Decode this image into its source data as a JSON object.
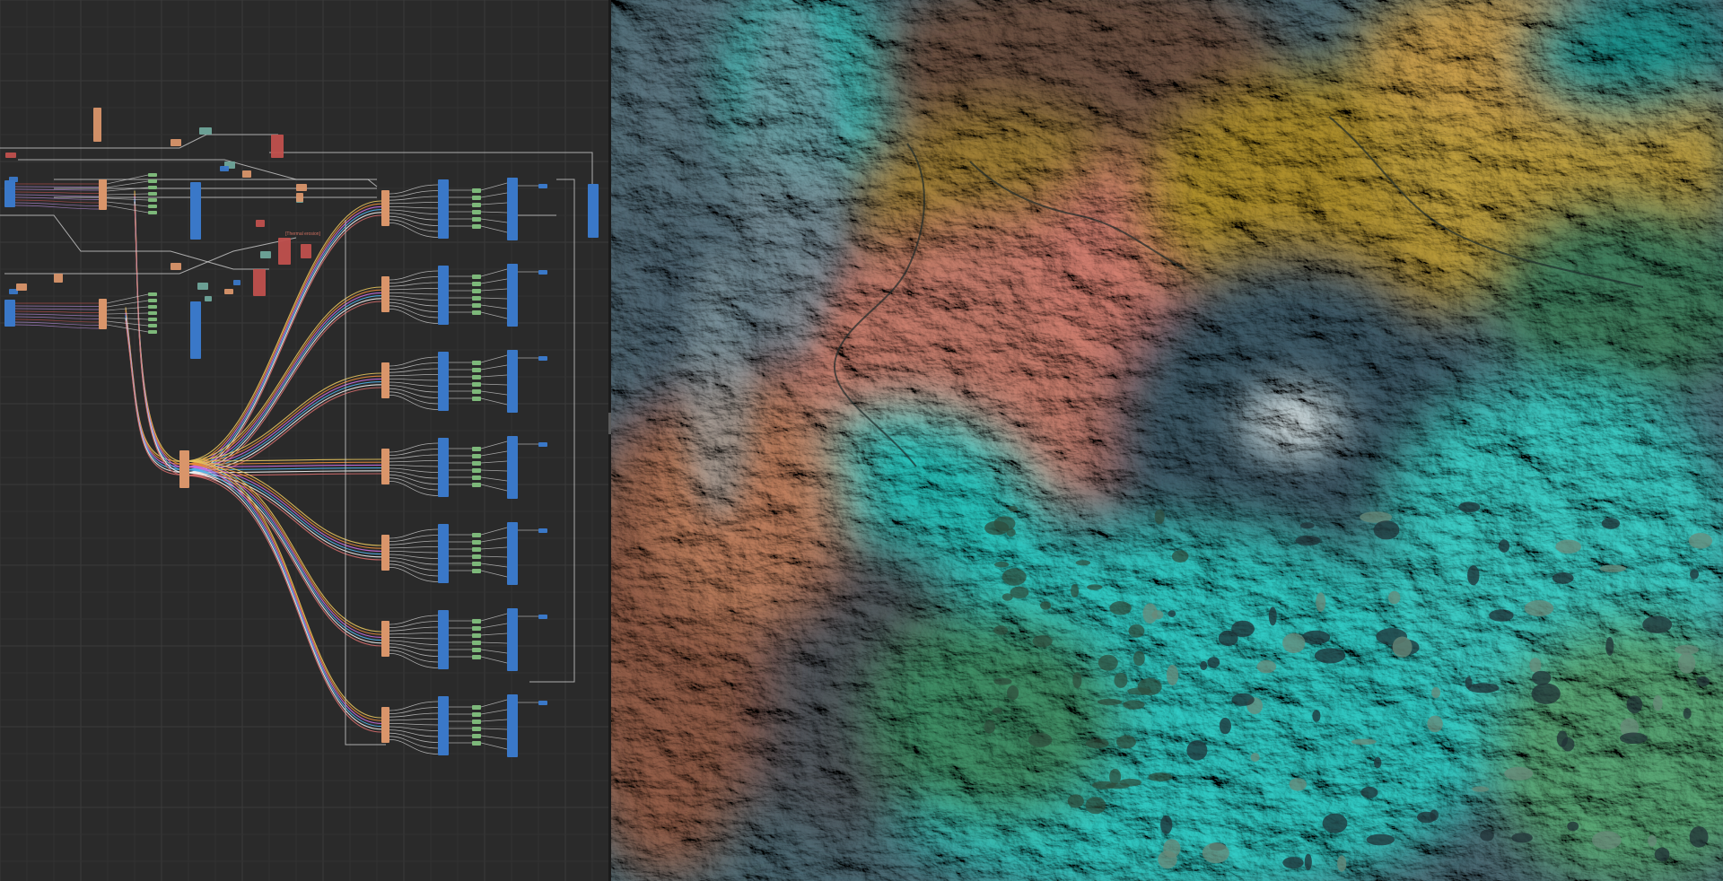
{
  "app": {
    "title": ""
  },
  "graph": {
    "annotation_label": "[Thermal erosion]",
    "colors": {
      "background": "#2a2a2a",
      "grid_minor": "#323232",
      "grid_major": "#3a3a3a",
      "wire": "#d8d8d8",
      "node_orange": "#d9956a",
      "node_blue": "#3a78c8",
      "node_green": "#7db87a",
      "node_red": "#c0504d",
      "node_teal": "#6fa59a",
      "bundle": [
        "#e6c35c",
        "#e58a3a",
        "#c86adf",
        "#4fb0e8",
        "#f0f0f0",
        "#d06a6a"
      ]
    },
    "group_rows": 7
  },
  "viewport": {
    "colors": {
      "rock_dark": "#2c3a44",
      "rock_light": "#9fb0b6",
      "snow": "#e8eff0",
      "teal": "#2fc4c0",
      "green": "#3e7a5a",
      "salmon": "#c8786a",
      "brown": "#8a5a3e",
      "olive": "#a08a2e",
      "yellow": "#c9a93a",
      "deep_teal": "#1f8f8a"
    }
  }
}
